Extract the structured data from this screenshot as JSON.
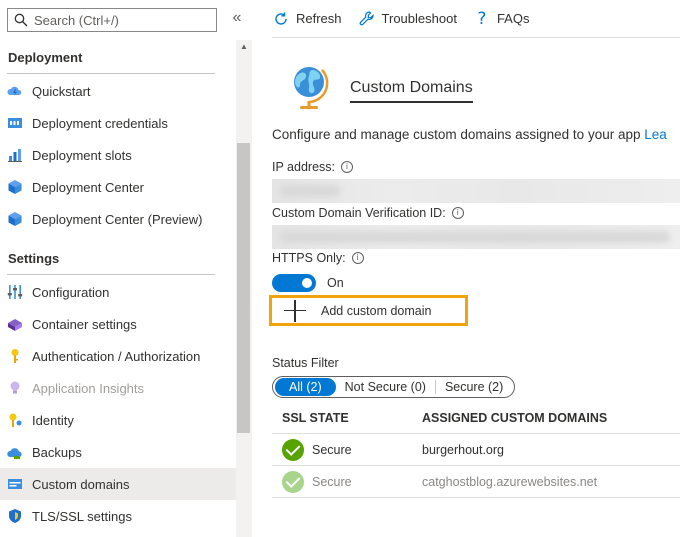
{
  "sidebar": {
    "search_placeholder": "Search (Ctrl+/)",
    "collapse_icon": "«",
    "sections": [
      {
        "title": "Deployment",
        "items": [
          {
            "label": "Quickstart",
            "icon": "cloud-bolt-icon"
          },
          {
            "label": "Deployment credentials",
            "icon": "credentials-icon"
          },
          {
            "label": "Deployment slots",
            "icon": "slots-icon"
          },
          {
            "label": "Deployment Center",
            "icon": "cube-icon"
          },
          {
            "label": "Deployment Center (Preview)",
            "icon": "cube-icon"
          }
        ]
      },
      {
        "title": "Settings",
        "items": [
          {
            "label": "Configuration",
            "icon": "sliders-icon"
          },
          {
            "label": "Container settings",
            "icon": "container-icon"
          },
          {
            "label": "Authentication / Authorization",
            "icon": "key-icon"
          },
          {
            "label": "Application Insights",
            "icon": "lightbulb-icon",
            "disabled": true
          },
          {
            "label": "Identity",
            "icon": "identity-key-icon"
          },
          {
            "label": "Backups",
            "icon": "cloud-backup-icon"
          },
          {
            "label": "Custom domains",
            "icon": "domain-icon",
            "selected": true
          },
          {
            "label": "TLS/SSL settings",
            "icon": "shield-icon"
          }
        ]
      }
    ]
  },
  "toolbar": {
    "refresh": "Refresh",
    "troubleshoot": "Troubleshoot",
    "faqs": "FAQs"
  },
  "main": {
    "title": "Custom Domains",
    "description": "Configure and manage custom domains assigned to your app",
    "learn_more": "Lea",
    "ip_address_label": "IP address:",
    "verification_id_label": "Custom Domain Verification ID:",
    "https_only_label": "HTTPS Only:",
    "https_only_state": "On",
    "https_only_value": true,
    "add_custom_domain": "Add custom domain",
    "status_filter_label": "Status Filter",
    "filters": [
      {
        "label": "All (2)",
        "active": true
      },
      {
        "label": "Not Secure (0)",
        "active": false
      },
      {
        "label": "Secure (2)",
        "active": false
      }
    ],
    "table": {
      "columns": [
        "SSL STATE",
        "ASSIGNED CUSTOM DOMAINS"
      ],
      "rows": [
        {
          "ssl_state": "Secure",
          "domain": "burgerhout.org",
          "faded": false
        },
        {
          "ssl_state": "Secure",
          "domain": "catghostblog.azurewebsites.net",
          "faded": true
        }
      ]
    }
  },
  "colors": {
    "accent": "#0078d4",
    "highlight_border": "#f0a30a",
    "secure_green": "#57a300"
  }
}
